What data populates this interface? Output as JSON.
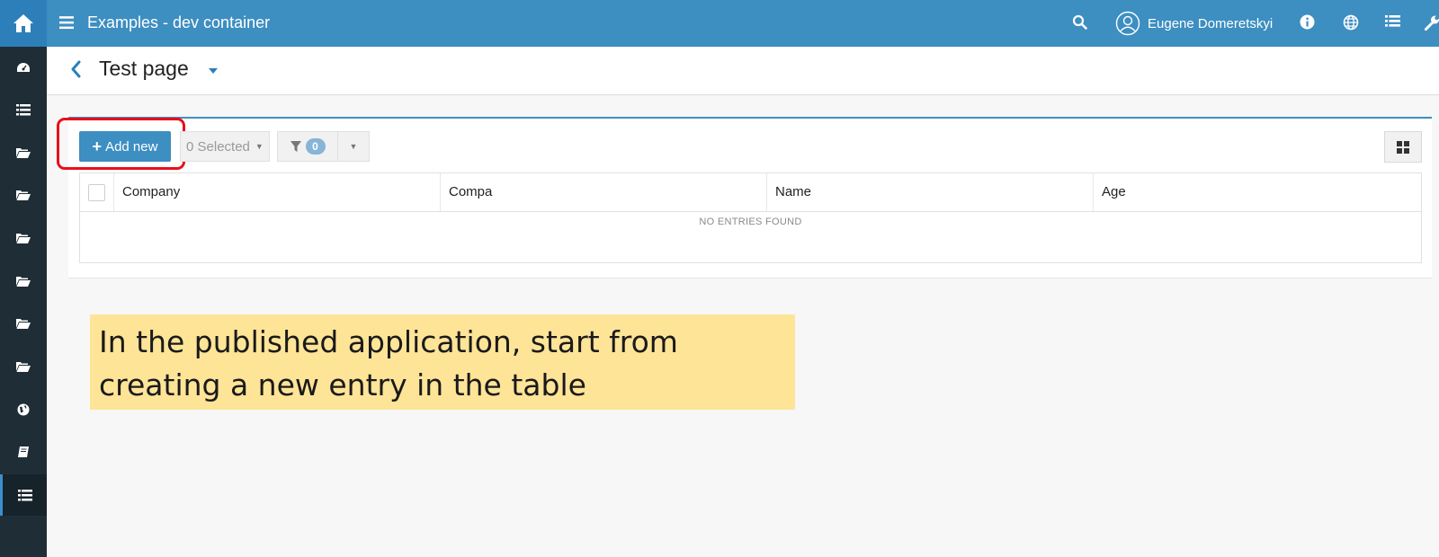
{
  "topbar": {
    "title": "Examples - dev container",
    "user_name": "Eugene Domeretskyi",
    "icons": [
      "home-icon",
      "menu-icon",
      "search-icon",
      "user-avatar-icon",
      "info-icon",
      "globe-icon",
      "list-icon",
      "wrench-icon"
    ]
  },
  "sidebar": {
    "items": [
      {
        "icon": "dashboard-icon"
      },
      {
        "icon": "list-icon"
      },
      {
        "icon": "folder-open-icon"
      },
      {
        "icon": "folder-open-icon"
      },
      {
        "icon": "folder-open-icon"
      },
      {
        "icon": "folder-open-icon"
      },
      {
        "icon": "folder-open-icon"
      },
      {
        "icon": "folder-open-icon"
      },
      {
        "icon": "globe-icon"
      },
      {
        "icon": "book-icon"
      },
      {
        "icon": "list-icon",
        "active": true
      }
    ]
  },
  "page": {
    "title": "Test page"
  },
  "toolbar": {
    "add_label": "Add new",
    "selected_label": "0 Selected",
    "filter_count": "0"
  },
  "table": {
    "columns": [
      "Company",
      "Compa",
      "Name",
      "Age"
    ],
    "empty_text": "NO ENTRIES FOUND"
  },
  "callout": {
    "line1": "In the published application, start from",
    "line2": "creating a new entry in the table"
  },
  "colors": {
    "topbar": "#3d8ec1",
    "sidebar": "#1f2d36",
    "accent": "#3d8ec1",
    "highlight": "#e8101a",
    "callout": "#fee497"
  }
}
